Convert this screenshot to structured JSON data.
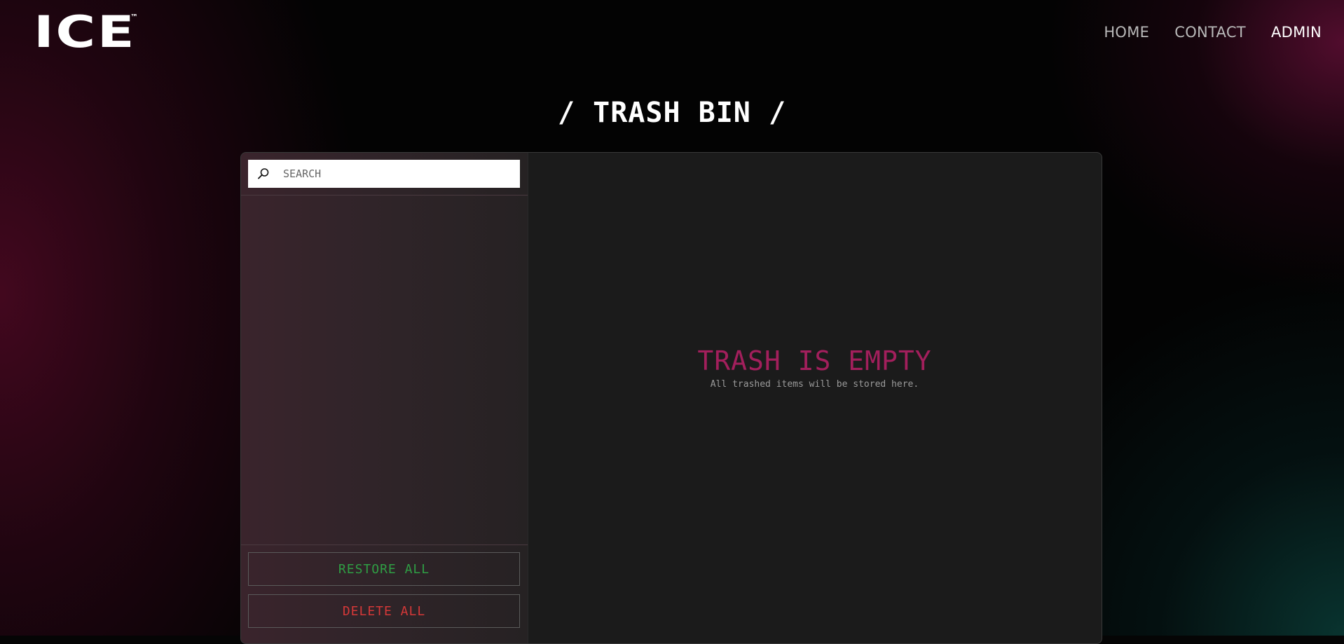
{
  "brand": {
    "logo_text": "ICE",
    "trademark": "™"
  },
  "nav": {
    "items": [
      {
        "label": "HOME"
      },
      {
        "label": "CONTACT"
      },
      {
        "label": "ADMIN"
      }
    ],
    "active": "ADMIN"
  },
  "page": {
    "title": "/ TRASH BIN /"
  },
  "sidebar": {
    "search": {
      "placeholder": "SEARCH",
      "value": ""
    },
    "items": [],
    "restore_all_label": "RESTORE ALL",
    "delete_all_label": "DELETE ALL"
  },
  "empty_state": {
    "title": "TRASH IS EMPTY",
    "subtitle": "All trashed items will be stored here."
  },
  "colors": {
    "accent_pink": "#a21f5c",
    "restore_green": "#2f9e44",
    "delete_red": "#d43838"
  },
  "icons": {
    "search": "search-icon"
  }
}
